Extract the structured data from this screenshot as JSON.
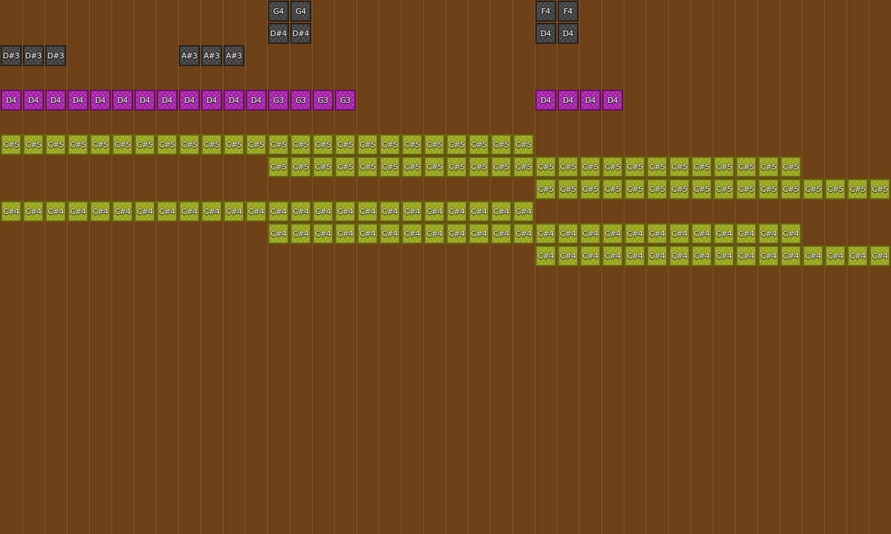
{
  "colors": {
    "background": "#6e4016",
    "grid_line": "#7d5530",
    "dark": "#3c3c3c",
    "magenta": "#a21aa4",
    "olive": "#95a012"
  },
  "rows": [
    {
      "lane": 0,
      "color": "dark",
      "runs": [
        {
          "start": 12,
          "notes": [
            "G4",
            "G4"
          ]
        },
        {
          "start": 24,
          "notes": [
            "F4",
            "F4"
          ]
        }
      ]
    },
    {
      "lane": 1,
      "color": "dark",
      "runs": [
        {
          "start": 12,
          "notes": [
            "D#4",
            "D#4"
          ]
        },
        {
          "start": 24,
          "notes": [
            "D4",
            "D4"
          ]
        }
      ]
    },
    {
      "lane": 2,
      "color": "dark",
      "runs": [
        {
          "start": 0,
          "notes": [
            "D#3",
            "D#3",
            "D#3"
          ]
        },
        {
          "start": 8,
          "notes": [
            "A#3",
            "A#3",
            "A#3"
          ]
        }
      ]
    },
    {
      "lane": 4,
      "color": "magenta",
      "runs": [
        {
          "start": 0,
          "notes": [
            "D4",
            "D4",
            "D4",
            "D4",
            "D4",
            "D4",
            "D4",
            "D4",
            "D4",
            "D4",
            "D4",
            "D4",
            "G3",
            "G3",
            "G3",
            "G3"
          ]
        },
        {
          "start": 24,
          "notes": [
            "D4",
            "D4",
            "D4",
            "D4"
          ]
        }
      ]
    },
    {
      "lane": 6,
      "color": "olive",
      "runs": [
        {
          "start": 0,
          "notes": [
            "C#5",
            "C#5",
            "C#5",
            "C#5",
            "C#5",
            "C#5",
            "C#5",
            "C#5",
            "C#5",
            "C#5",
            "C#5",
            "C#5",
            "C#5",
            "C#5",
            "C#5",
            "C#5",
            "C#5",
            "C#5",
            "C#5",
            "C#5",
            "C#5",
            "C#5",
            "C#5",
            "C#5"
          ]
        }
      ]
    },
    {
      "lane": 7,
      "color": "olive",
      "runs": [
        {
          "start": 12,
          "notes": [
            "C#5",
            "C#5",
            "C#5",
            "C#5",
            "C#5",
            "C#5",
            "C#5",
            "C#5",
            "C#5",
            "C#5",
            "C#5",
            "C#5",
            "C#5",
            "C#5",
            "C#5",
            "C#5",
            "C#5",
            "C#5",
            "C#5",
            "C#5",
            "C#5",
            "C#5",
            "C#5",
            "C#5"
          ]
        }
      ]
    },
    {
      "lane": 8,
      "color": "olive",
      "runs": [
        {
          "start": 24,
          "notes": [
            "C#5",
            "C#5",
            "C#5",
            "C#5",
            "C#5",
            "C#5",
            "C#5",
            "C#5",
            "C#5",
            "C#5",
            "C#5",
            "C#5",
            "C#5",
            "C#5",
            "C#5",
            "C#5"
          ]
        }
      ]
    },
    {
      "lane": 9,
      "color": "olive",
      "runs": [
        {
          "start": 0,
          "notes": [
            "C#4",
            "C#4",
            "C#4",
            "C#4",
            "C#4",
            "C#4",
            "C#4",
            "C#4",
            "C#4",
            "C#4",
            "C#4",
            "C#4",
            "C#4",
            "C#4",
            "C#4",
            "C#4",
            "C#4",
            "C#4",
            "C#4",
            "C#4",
            "C#4",
            "C#4",
            "C#4",
            "C#4"
          ]
        }
      ]
    },
    {
      "lane": 10,
      "color": "olive",
      "runs": [
        {
          "start": 12,
          "notes": [
            "C#4",
            "C#4",
            "C#4",
            "C#4",
            "C#4",
            "C#4",
            "C#4",
            "C#4",
            "C#4",
            "C#4",
            "C#4",
            "C#4",
            "C#4",
            "C#4",
            "C#4",
            "C#4",
            "C#4",
            "C#4",
            "C#4",
            "C#4",
            "C#4",
            "C#4",
            "C#4",
            "C#4"
          ]
        }
      ]
    },
    {
      "lane": 11,
      "color": "olive",
      "runs": [
        {
          "start": 24,
          "notes": [
            "C#4",
            "C#4",
            "C#4",
            "C#4",
            "C#4",
            "C#4",
            "C#4",
            "C#4",
            "C#4",
            "C#4",
            "C#4",
            "C#4",
            "C#4",
            "C#4",
            "C#4",
            "C#4"
          ]
        }
      ]
    }
  ]
}
